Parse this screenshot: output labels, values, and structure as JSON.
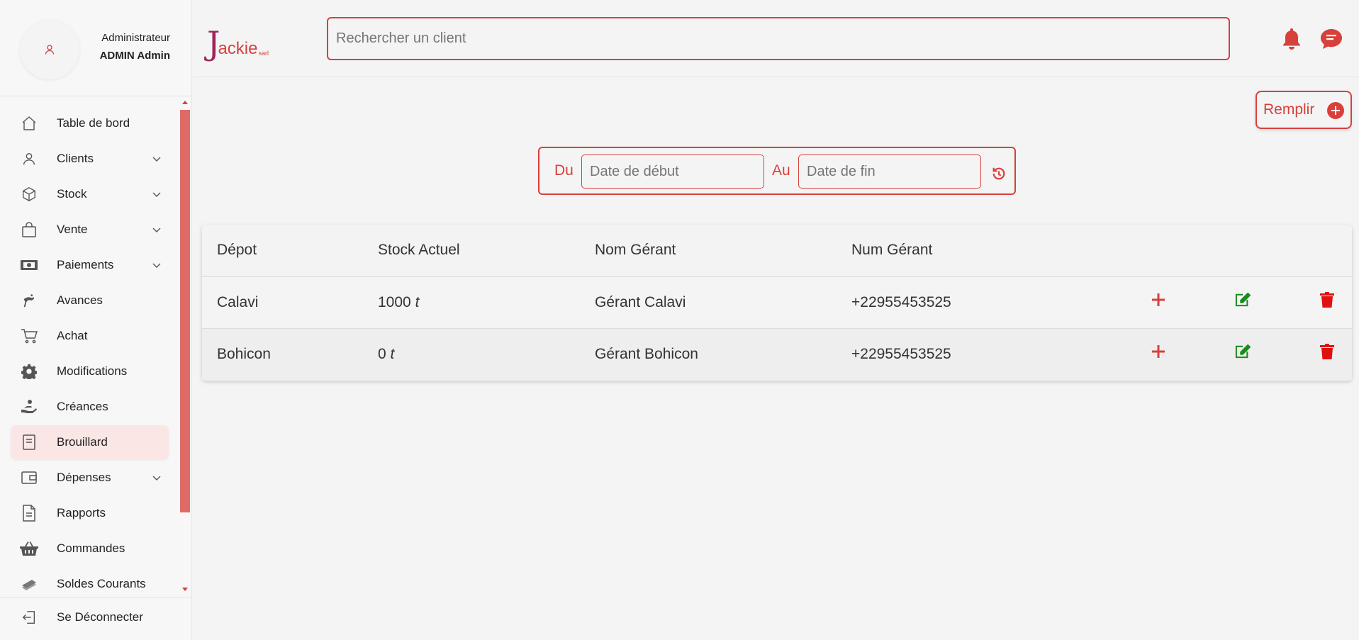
{
  "profile": {
    "role": "Administrateur",
    "name": "ADMIN Admin"
  },
  "logo": {
    "initial": "J",
    "rest": "ackie",
    "suffix": "sarl"
  },
  "search": {
    "placeholder": "Rechercher un client"
  },
  "menu": [
    {
      "label": "Table de bord",
      "icon": "home-icon",
      "chevron": false
    },
    {
      "label": "Clients",
      "icon": "user-icon",
      "chevron": true
    },
    {
      "label": "Stock",
      "icon": "box-icon",
      "chevron": true
    },
    {
      "label": "Vente",
      "icon": "shopping-bag-icon",
      "chevron": true
    },
    {
      "label": "Paiements",
      "icon": "money-icon",
      "chevron": true
    },
    {
      "label": "Avances",
      "icon": "hand-coins-icon",
      "chevron": false
    },
    {
      "label": "Achat",
      "icon": "cart-icon",
      "chevron": false
    },
    {
      "label": "Modifications",
      "icon": "gear-icon",
      "chevron": false
    },
    {
      "label": "Créances",
      "icon": "hand-holding-icon",
      "chevron": false
    },
    {
      "label": "Brouillard",
      "icon": "notebook-icon",
      "chevron": false,
      "active": true
    },
    {
      "label": "Dépenses",
      "icon": "wallet-icon",
      "chevron": true
    },
    {
      "label": "Rapports",
      "icon": "document-icon",
      "chevron": false
    },
    {
      "label": "Commandes",
      "icon": "basket-icon",
      "chevron": false
    },
    {
      "label": "Soldes Courants",
      "icon": "money-stack-icon",
      "chevron": false
    }
  ],
  "logout": {
    "label": "Se Déconnecter"
  },
  "actions": {
    "remplir_label": "Remplir"
  },
  "date_filter": {
    "from_label": "Du",
    "to_label": "Au",
    "from_placeholder": "Date de début",
    "to_placeholder": "Date de fin"
  },
  "table": {
    "headers": [
      "Dépot",
      "Stock Actuel",
      "Nom Gérant",
      "Num Gérant"
    ],
    "rows": [
      {
        "depot": "Calavi",
        "stock": "1000",
        "unit": "t",
        "manager": "Gérant Calavi",
        "phone": "+22955453525"
      },
      {
        "depot": "Bohicon",
        "stock": "0",
        "unit": "t",
        "manager": "Gérant Bohicon",
        "phone": "+22955453525"
      }
    ]
  },
  "colors": {
    "accent": "#d8403b",
    "edit": "#1a8a1a",
    "delete": "#e01010",
    "active_bg": "#fbe6e6"
  }
}
